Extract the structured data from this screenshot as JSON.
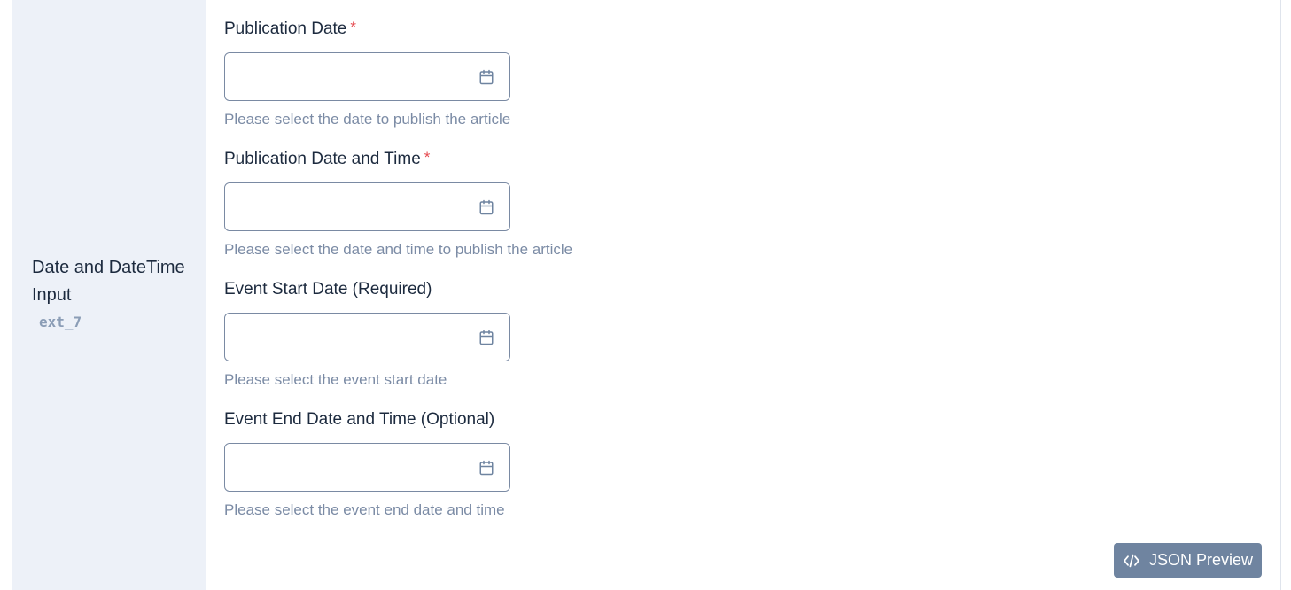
{
  "section": {
    "title": "Date and DateTime Input",
    "id": "ext_7"
  },
  "fields": [
    {
      "label": "Publication Date",
      "required_mark": "*",
      "value": "",
      "help": "Please select the date to publish the article",
      "icon": "calendar-icon"
    },
    {
      "label": "Publication Date and Time",
      "required_mark": "*",
      "value": "",
      "help": "Please select the date and time to publish the article",
      "icon": "calendar-icon"
    },
    {
      "label": "Event Start Date (Required)",
      "value": "",
      "help": "Please select the event start date",
      "icon": "calendar-icon"
    },
    {
      "label": "Event End Date and Time (Optional)",
      "value": "",
      "help": "Please select the event end date and time",
      "icon": "calendar-icon"
    }
  ],
  "json_preview": {
    "label": "JSON Preview",
    "icon": "code-icon"
  },
  "colors": {
    "sidebar_bg": "#edf1f8",
    "required": "#e5484d",
    "help_text": "#7b8ba5",
    "button_bg": "#6f84a0"
  }
}
